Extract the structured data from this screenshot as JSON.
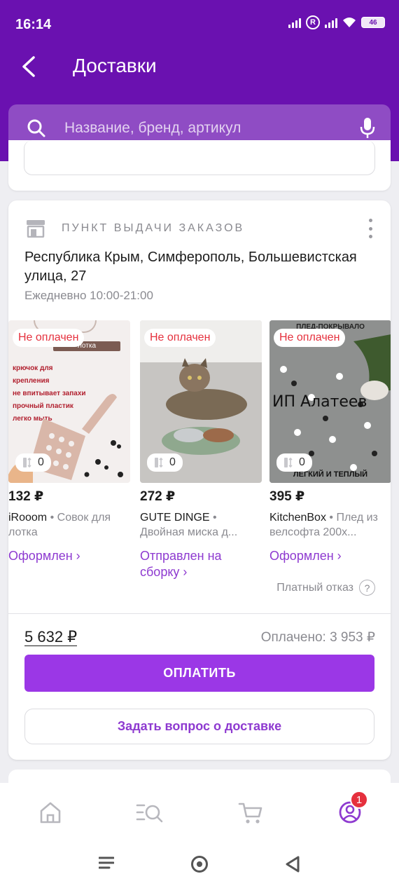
{
  "status_bar": {
    "time": "16:14",
    "r_badge": "R",
    "battery": "46"
  },
  "header": {
    "title": "Доставки"
  },
  "search": {
    "placeholder": "Название, бренд, артикул"
  },
  "top_card": {
    "ask_label": "Задать вопрос о доставке"
  },
  "order": {
    "pickup_label": "ПУНКТ ВЫДАЧИ ЗАКАЗОВ",
    "address": "Республика Крым, Симферополь, Большевистская улица, 27",
    "hours": "Ежедневно 10:00-21:00",
    "products": [
      {
        "badge": "Не оплачен",
        "count": "0",
        "price": "132 ₽",
        "brand": "iRooom",
        "sep": " • ",
        "name": "Совок для лотка",
        "status": "Оформлен ›",
        "img_lines": [
          "крючок для крепления",
          "не впитывает запахи",
          "прочный пластик",
          "легко мыть"
        ],
        "img_header": "лотка"
      },
      {
        "badge": "Не оплачен",
        "count": "0",
        "price": "272 ₽",
        "brand": "GUTE DINGE",
        "sep": " • ",
        "name": "Двойная миска д...",
        "status": "Отправлен на сборку ›"
      },
      {
        "badge": "Не оплачен",
        "count": "0",
        "price": "395 ₽",
        "brand": "KitchenBox",
        "sep": " • ",
        "name": "Плед из велсофта 200х...",
        "status": "Оформлен ›",
        "img_top": "ПЛЕД-ПОКРЫВАЛО",
        "img_mid": "ИП Алатеев",
        "img_bottom": "ЛЕГКИЙ И ТЕПЛЫЙ"
      }
    ],
    "paid_refusal": "Платный отказ",
    "qmark": "?",
    "total": "5 632 ₽",
    "paid": "Оплачено: 3 953 ₽",
    "pay_label": "ОПЛАТИТЬ",
    "ask_label": "Задать вопрос о доставке"
  },
  "nav": {
    "profile_badge": "1"
  },
  "colors": {
    "header": "#6a11b0",
    "accent": "#9b37e6",
    "link": "#8e3ad0",
    "unpaid": "#e5303d"
  }
}
